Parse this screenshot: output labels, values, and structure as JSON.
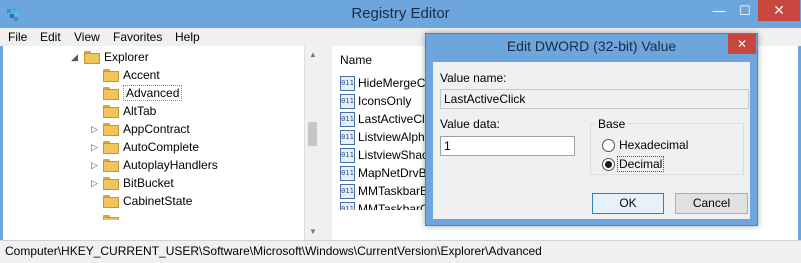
{
  "window": {
    "title": "Registry Editor"
  },
  "titlebar_buttons": {
    "minimize": "—",
    "maximize": "☐",
    "close": "✕"
  },
  "menu": [
    "File",
    "Edit",
    "View",
    "Favorites",
    "Help"
  ],
  "tree": {
    "parent": "Explorer",
    "items": [
      {
        "label": "Accent",
        "expandable": false
      },
      {
        "label": "Advanced",
        "expandable": false,
        "selected": true
      },
      {
        "label": "AltTab",
        "expandable": false
      },
      {
        "label": "AppContract",
        "expandable": true
      },
      {
        "label": "AutoComplete",
        "expandable": true
      },
      {
        "label": "AutoplayHandlers",
        "expandable": true
      },
      {
        "label": "BitBucket",
        "expandable": true
      },
      {
        "label": "CabinetState",
        "expandable": false
      }
    ]
  },
  "list": {
    "column_name": "Name",
    "rows": [
      {
        "icon": "dword-value-icon",
        "name": "HideMergeCo"
      },
      {
        "icon": "dword-value-icon",
        "name": "IconsOnly"
      },
      {
        "icon": "dword-value-icon",
        "name": "LastActiveCli"
      },
      {
        "icon": "dword-value-icon",
        "name": "ListviewAlpha"
      },
      {
        "icon": "dword-value-icon",
        "name": "ListviewShad"
      },
      {
        "icon": "dword-value-icon",
        "name": "MapNetDrvBt"
      },
      {
        "icon": "dword-value-icon",
        "name": "MMTaskbarE"
      },
      {
        "icon": "dword-value-icon",
        "name": "MMTaskbarG"
      }
    ]
  },
  "status": {
    "path": "Computer\\HKEY_CURRENT_USER\\Software\\Microsoft\\Windows\\CurrentVersion\\Explorer\\Advanced"
  },
  "dialog": {
    "title": "Edit DWORD (32-bit) Value",
    "close": "✕",
    "value_name_label": "Value name:",
    "value_name": "LastActiveClick",
    "value_data_label": "Value data:",
    "value_data": "1",
    "base_label": "Base",
    "base_options": [
      {
        "label": "Hexadecimal",
        "selected": false
      },
      {
        "label": "Decimal",
        "selected": true
      }
    ],
    "ok": "OK",
    "cancel": "Cancel"
  },
  "colors": {
    "frame": "#6da5dd",
    "close": "#c7463d",
    "dialog_bg": "#f0f0f0"
  }
}
